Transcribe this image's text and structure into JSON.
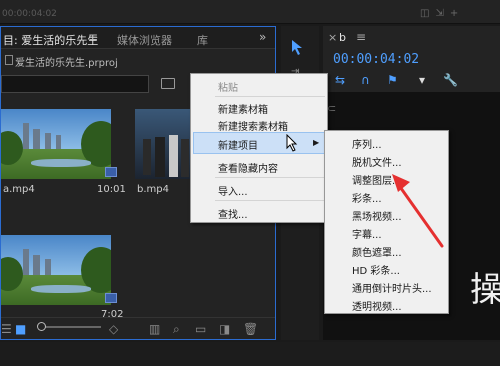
{
  "top_strip": {
    "timecode": "00:00:04:02"
  },
  "project_panel": {
    "tabs": [
      {
        "label": "目: 爱生活的乐先生"
      },
      {
        "label": "媒体浏览器"
      },
      {
        "label": "库"
      }
    ],
    "menu_glyph": "≡",
    "overflow_glyph": "»",
    "file_name": "爱生活的乐先生.prproj",
    "clips": [
      {
        "name": "a.mp4",
        "duration": "10:01"
      },
      {
        "name": "b.mp4",
        "duration": ""
      },
      {
        "name": "",
        "duration": "7:02"
      }
    ]
  },
  "program_monitor": {
    "tab_label": "b",
    "menu_glyph": "≡",
    "timecode": "00:00:04:02"
  },
  "context_menu": {
    "items": [
      {
        "label": "粘贴",
        "disabled": true
      },
      {
        "label": "新建素材箱",
        "disabled": false
      },
      {
        "label": "新建搜索素材箱",
        "disabled": false
      },
      {
        "label": "新建项目",
        "disabled": false,
        "has_submenu": true
      },
      {
        "label": "查看隐藏内容",
        "disabled": false
      },
      {
        "label": "导入...",
        "disabled": false
      },
      {
        "label": "查找...",
        "disabled": false
      }
    ],
    "submenu_arrow": "▶"
  },
  "submenu": {
    "items": [
      {
        "label": "序列..."
      },
      {
        "label": "脱机文件..."
      },
      {
        "label": "调整图层..."
      },
      {
        "label": "彩条..."
      },
      {
        "label": "黑场视频..."
      },
      {
        "label": "字幕..."
      },
      {
        "label": "颜色遮罩..."
      },
      {
        "label": "HD 彩条..."
      },
      {
        "label": "通用倒计时片头..."
      },
      {
        "label": "透明视频..."
      }
    ]
  },
  "overlay": {
    "char": "操"
  },
  "colors": {
    "accent_blue": "#4f9fff",
    "panel_border": "#2b6cd1",
    "annotation_arrow": "#e53030"
  }
}
